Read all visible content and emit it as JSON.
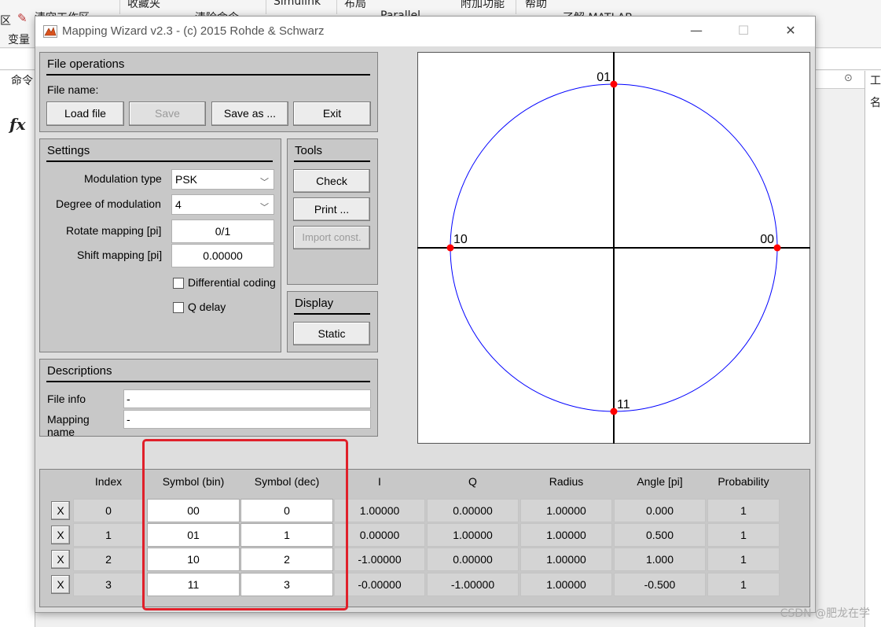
{
  "background": {
    "toolbar_items": [
      "区",
      "清空工作区",
      "收藏夹",
      "清除命令",
      "Simulink",
      "布局",
      "Parallel",
      "附加功能",
      "帮助",
      "了解 MATLAB"
    ],
    "variable_label": "变量",
    "command_tab": "命令",
    "fx_symbol": "fx",
    "right_tab": "工",
    "right_col": "名"
  },
  "window": {
    "title": "Mapping Wizard v2.3 -  (c) 2015 Rohde & Schwarz",
    "minimize": "—",
    "maximize": "☐",
    "close": "✕"
  },
  "file_operations": {
    "title": "File operations",
    "file_name_label": "File name:",
    "buttons": {
      "load": "Load file",
      "save": "Save",
      "save_as": "Save as ...",
      "exit": "Exit"
    }
  },
  "settings": {
    "title": "Settings",
    "modulation_type_label": "Modulation type",
    "modulation_type_value": "PSK",
    "degree_label": "Degree of modulation",
    "degree_value": "4",
    "rotate_label": "Rotate mapping [pi]",
    "rotate_value": "0/1",
    "shift_label": "Shift mapping [pi]",
    "shift_value": "0.00000",
    "differential_coding": "Differential coding",
    "q_delay": "Q delay"
  },
  "tools": {
    "title": "Tools",
    "check": "Check",
    "print": "Print ...",
    "import": "Import const."
  },
  "display": {
    "title": "Display",
    "static": "Static"
  },
  "descriptions": {
    "title": "Descriptions",
    "file_info_label": "File info",
    "file_info_value": "-",
    "mapping_name_label": "Mapping name",
    "mapping_name_value": "-"
  },
  "plot": {
    "circle_color": "#0000ff",
    "point_color": "#ff0000",
    "points": [
      {
        "label": "00",
        "i": 1.0,
        "q": 0.0
      },
      {
        "label": "01",
        "i": 0.0,
        "q": 1.0
      },
      {
        "label": "10",
        "i": -1.0,
        "q": 0.0
      },
      {
        "label": "11",
        "i": 0.0,
        "q": -1.0
      }
    ]
  },
  "table": {
    "headers": [
      "Index",
      "Symbol (bin)",
      "Symbol (dec)",
      "I",
      "Q",
      "Radius",
      "Angle [pi]",
      "Probability"
    ],
    "delete_label": "X",
    "rows": [
      {
        "index": "0",
        "bin": "00",
        "dec": "0",
        "i": "1.00000",
        "q": "0.00000",
        "radius": "1.00000",
        "angle": "0.000",
        "prob": "1"
      },
      {
        "index": "1",
        "bin": "01",
        "dec": "1",
        "i": "0.00000",
        "q": "1.00000",
        "radius": "1.00000",
        "angle": "0.500",
        "prob": "1"
      },
      {
        "index": "2",
        "bin": "10",
        "dec": "2",
        "i": "-1.00000",
        "q": "0.00000",
        "radius": "1.00000",
        "angle": "1.000",
        "prob": "1"
      },
      {
        "index": "3",
        "bin": "11",
        "dec": "3",
        "i": "-0.00000",
        "q": "-1.00000",
        "radius": "1.00000",
        "angle": "-0.500",
        "prob": "1"
      }
    ]
  },
  "watermark": "CSDN @肥龙在学"
}
